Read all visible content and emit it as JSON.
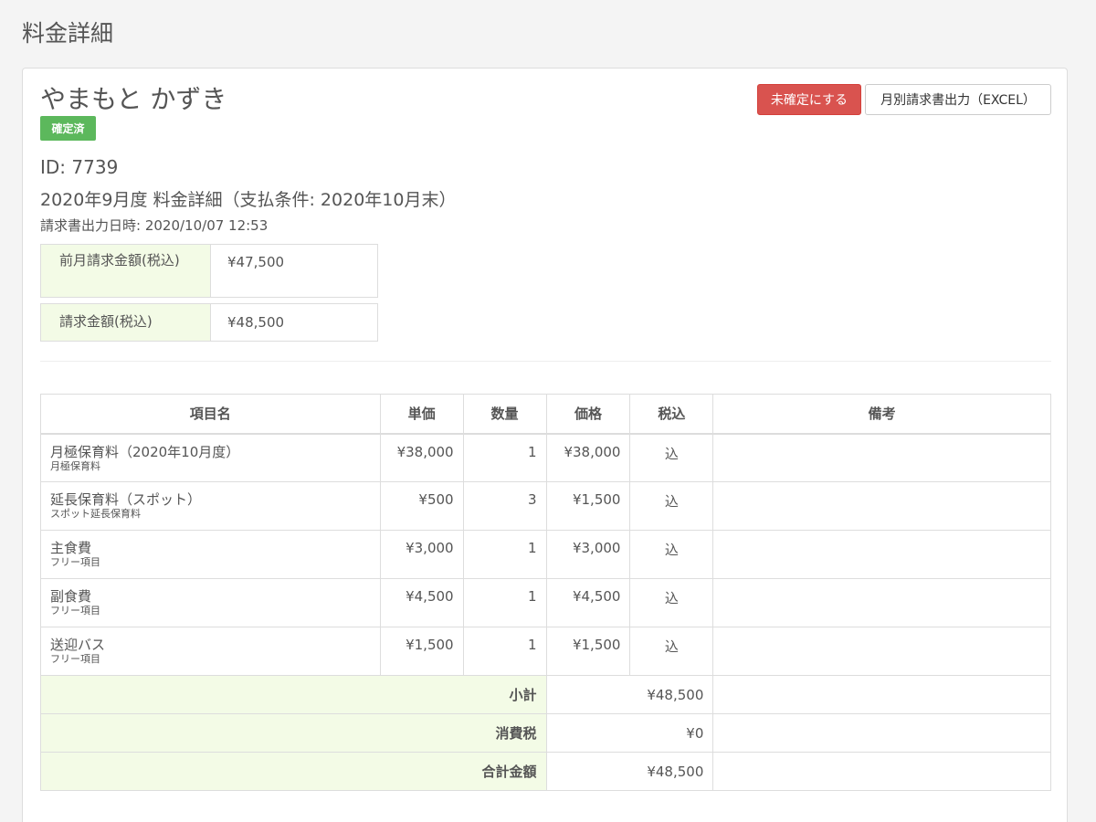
{
  "page": {
    "title": "料金詳細"
  },
  "person": {
    "name": "やまもと かずき",
    "status_badge": "確定済",
    "id_line": "ID: 7739",
    "period_line": "2020年9月度 料金詳細（支払条件: 2020年10月末）",
    "output_date": "請求書出力日時: 2020/10/07 12:53"
  },
  "actions": {
    "unconfirm_label": "未確定にする",
    "excel_label": "月別請求書出力（EXCEL）"
  },
  "summary": {
    "prev_label": "前月請求金額(税込)",
    "prev_value": "¥47,500",
    "current_label": "請求金額(税込)",
    "current_value": "¥48,500"
  },
  "table": {
    "headers": {
      "name": "項目名",
      "unit_price": "単価",
      "quantity": "数量",
      "price": "価格",
      "tax": "税込",
      "notes": "備考"
    },
    "rows": [
      {
        "name": "月極保育料（2020年10月度）",
        "sub": "月極保育料",
        "unit_price": "¥38,000",
        "quantity": "1",
        "price": "¥38,000",
        "tax": "込",
        "notes": ""
      },
      {
        "name": "延長保育料（スポット）",
        "sub": "スポット延長保育料",
        "unit_price": "¥500",
        "quantity": "3",
        "price": "¥1,500",
        "tax": "込",
        "notes": ""
      },
      {
        "name": "主食費",
        "sub": "フリー項目",
        "unit_price": "¥3,000",
        "quantity": "1",
        "price": "¥3,000",
        "tax": "込",
        "notes": ""
      },
      {
        "name": "副食費",
        "sub": "フリー項目",
        "unit_price": "¥4,500",
        "quantity": "1",
        "price": "¥4,500",
        "tax": "込",
        "notes": ""
      },
      {
        "name": "送迎バス",
        "sub": "フリー項目",
        "unit_price": "¥1,500",
        "quantity": "1",
        "price": "¥1,500",
        "tax": "込",
        "notes": ""
      }
    ],
    "totals": [
      {
        "label": "小計",
        "value": "¥48,500"
      },
      {
        "label": "消費税",
        "value": "¥0"
      },
      {
        "label": "合計金額",
        "value": "¥48,500"
      }
    ]
  },
  "colors": {
    "badge": "#5cb85c",
    "danger": "#d9534f",
    "label_bg": "#f3fbe6"
  }
}
